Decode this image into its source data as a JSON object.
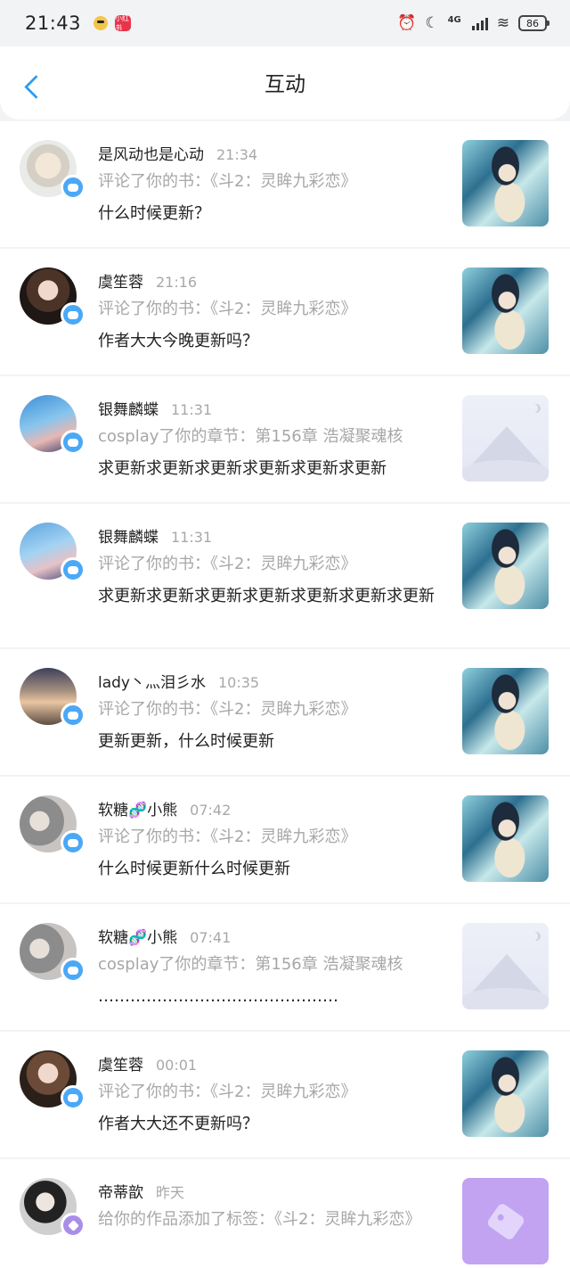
{
  "status_bar": {
    "time": "21:43",
    "app_badge": "小红书",
    "network": "4G",
    "battery": "86"
  },
  "header": {
    "title": "互动"
  },
  "items": [
    {
      "name": "是风动也是心动",
      "time": "21:34",
      "action": "评论了你的书：《斗2：灵眸九彩恋》",
      "content": "什么时候更新？",
      "thumb": "cover-art",
      "badge": "comment"
    },
    {
      "name": "虞笙蓉",
      "time": "21:16",
      "action": "评论了你的书：《斗2：灵眸九彩恋》",
      "content": "作者大大今晚更新吗？",
      "thumb": "cover-art",
      "badge": "comment"
    },
    {
      "name": "银舞麟蝶",
      "time": "11:31",
      "action": "cosplay了你的章节：第156章 浩凝聚魂核",
      "content": "求更新求更新求更新求更新求更新求更新",
      "thumb": "placeholder",
      "badge": "comment"
    },
    {
      "name": "银舞麟蝶",
      "time": "11:31",
      "action": "评论了你的书：《斗2：灵眸九彩恋》",
      "content": "求更新求更新求更新求更新求更新求更新求更新",
      "thumb": "cover-art",
      "badge": "comment"
    },
    {
      "name": "lady丶灬泪彡水",
      "time": "10:35",
      "action": "评论了你的书：《斗2：灵眸九彩恋》",
      "content": "更新更新，什么时候更新",
      "thumb": "cover-art",
      "badge": "comment"
    },
    {
      "name": "软糖🧬小熊",
      "time": "07:42",
      "action": "评论了你的书：《斗2：灵眸九彩恋》",
      "content": "什么时候更新什么时候更新",
      "thumb": "cover-art",
      "badge": "comment"
    },
    {
      "name": "软糖🧬小熊",
      "time": "07:41",
      "action": "cosplay了你的章节：第156章 浩凝聚魂核",
      "content": "………………………………………",
      "thumb": "placeholder",
      "badge": "comment"
    },
    {
      "name": "虞笙蓉",
      "time": "00:01",
      "action": "评论了你的书：《斗2：灵眸九彩恋》",
      "content": "作者大大还不更新吗？",
      "thumb": "cover-art",
      "badge": "comment"
    },
    {
      "name": "帝蒂歆",
      "time": "昨天",
      "action": "给你的作品添加了标签：《斗2：灵眸九彩恋》",
      "content": "",
      "thumb": "tag",
      "badge": "tag"
    }
  ]
}
